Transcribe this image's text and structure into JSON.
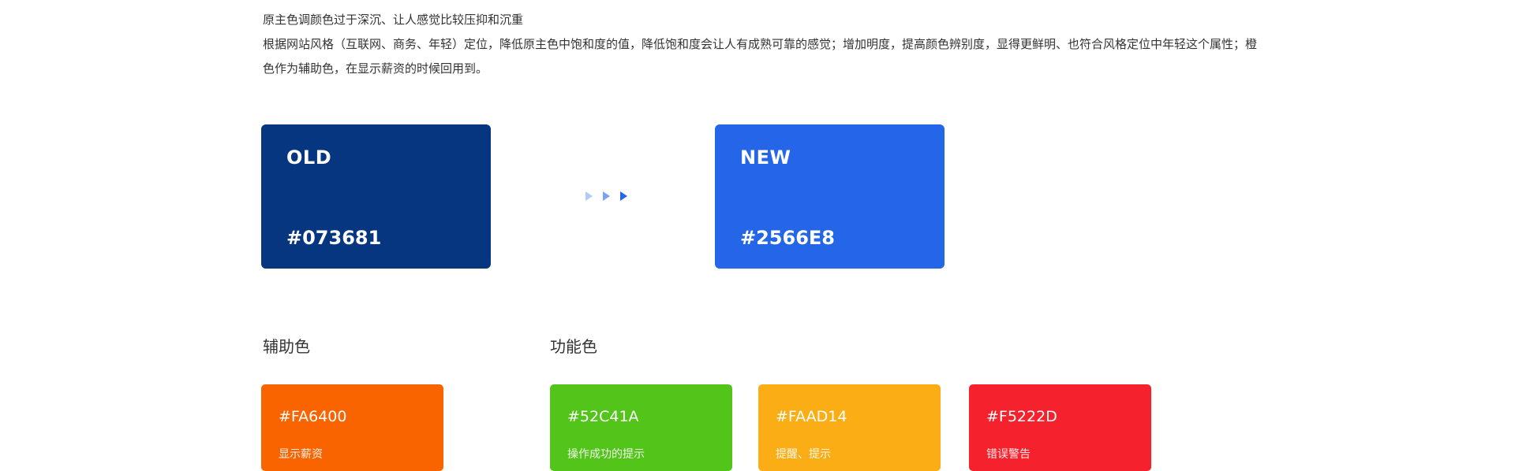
{
  "intro": {
    "line1": "原主色调颜色过于深沉、让人感觉比较压抑和沉重",
    "line2": "根据网站风格（互联网、商务、年轻）定位，降低原主色中饱和度的值，降低饱和度会让人有成熟可靠的感觉；增加明度，提高颜色辨别度，显得更鲜明、也符合风格定位中年轻这个属性；橙色作为辅助色，在显示薪资的时候回用到。"
  },
  "primary": {
    "old": {
      "label": "OLD",
      "hex": "#073681",
      "color": "#073681"
    },
    "new": {
      "label": "NEW",
      "hex": "#2566E8",
      "color": "#2566E8"
    }
  },
  "auxiliary": {
    "title": "辅助色",
    "swatches": [
      {
        "hex": "#FA6400",
        "color": "#FA6400",
        "desc": "显示薪资"
      }
    ]
  },
  "functional": {
    "title": "功能色",
    "swatches": [
      {
        "hex": "#52C41A",
        "color": "#52C41A",
        "desc": "操作成功的提示"
      },
      {
        "hex": "#FAAD14",
        "color": "#FAAD14",
        "desc": "提醒、提示"
      },
      {
        "hex": "#F5222D",
        "color": "#F5222D",
        "desc": "错误警告"
      }
    ]
  },
  "colors": {
    "arrow": "#2566E8"
  }
}
